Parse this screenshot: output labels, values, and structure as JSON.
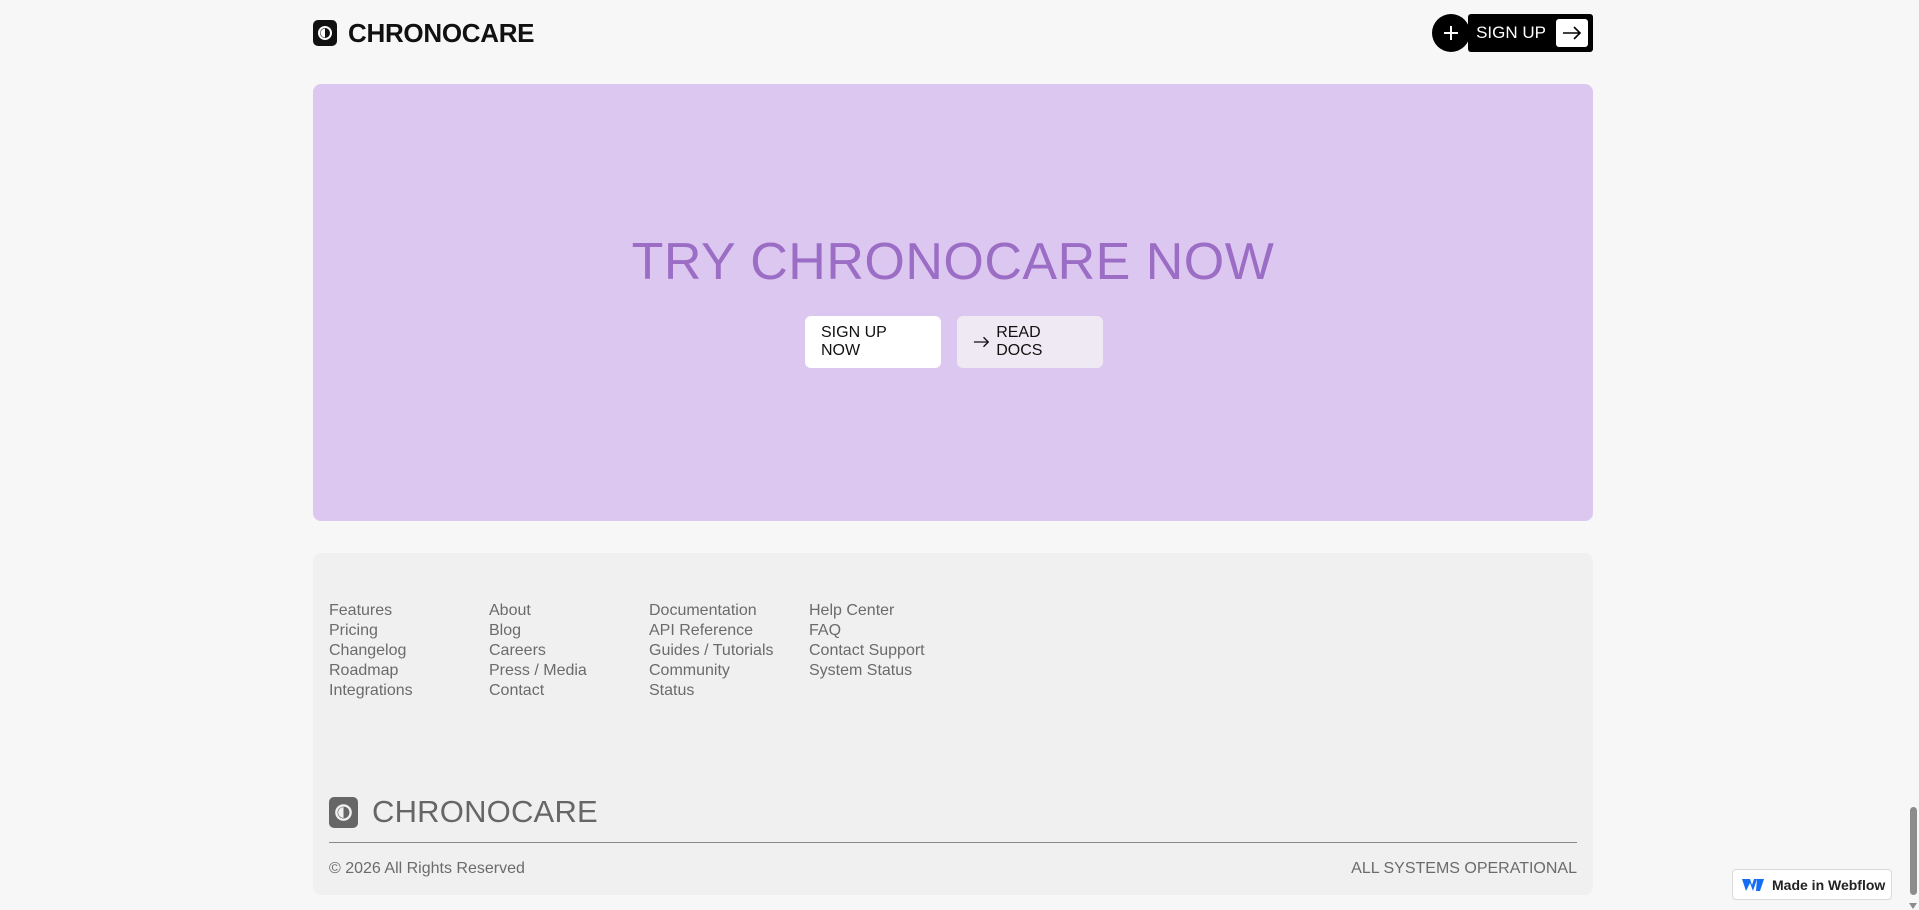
{
  "header": {
    "brand": "CHRONOCARE",
    "signup_label": "SIGN UP"
  },
  "cta": {
    "title": "TRY CHRONOCARE NOW",
    "primary_button": "SIGN UP NOW",
    "secondary_button": "READ DOCS"
  },
  "footer": {
    "col1": [
      "Features",
      "Pricing",
      "Changelog",
      "Roadmap",
      "Integrations"
    ],
    "col2": [
      "About",
      "Blog",
      "Careers",
      "Press / Media",
      "Contact"
    ],
    "col3": [
      "Documentation",
      "API Reference",
      "Guides / Tutorials",
      "Community Status"
    ],
    "col4": [
      "Help Center",
      "FAQ",
      "Contact Support",
      "System Status"
    ],
    "brand": "CHRONOCARE",
    "copyright": "© 2026 All Rights Reserved",
    "status": "ALL SYSTEMS OPERATIONAL"
  },
  "badge": {
    "label": "Made in Webflow"
  },
  "colors": {
    "cta_background": "#dcc7f1",
    "cta_title": "#9b6dc4",
    "page_background": "#f7f7f7",
    "footer_background": "#f0f0f0"
  },
  "icons": [
    "clock-logo-icon",
    "plus-icon",
    "arrow-right-icon",
    "webflow-logo-icon"
  ]
}
